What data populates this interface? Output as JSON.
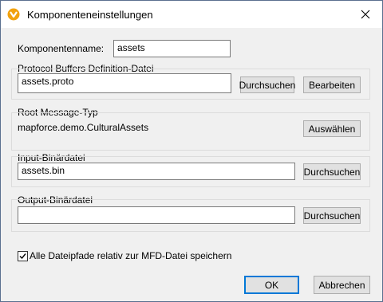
{
  "window": {
    "title": "Komponenteneinstellungen",
    "app_icon": "mapforce-icon",
    "close_icon": "close-icon"
  },
  "component_name": {
    "label": "Komponentenname:",
    "value": "assets"
  },
  "proto_file": {
    "group_label": "Protocol Buffers Definition-Datei",
    "value": "assets.proto",
    "browse_label": "Durchsuchen",
    "edit_label": "Bearbeiten"
  },
  "root_message": {
    "group_label": "Root Message-Typ",
    "value": "mapforce.demo.CulturalAssets",
    "select_label": "Auswählen"
  },
  "input_file": {
    "group_label": "Input-Binärdatei",
    "value": "assets.bin",
    "browse_label": "Durchsuchen"
  },
  "output_file": {
    "group_label": "Output-Binärdatei",
    "value": "",
    "browse_label": "Durchsuchen"
  },
  "relative_paths": {
    "label": "Alle Dateipfade relativ zur MFD-Datei speichern",
    "checked": true
  },
  "footer": {
    "ok_label": "OK",
    "cancel_label": "Abbrechen"
  },
  "colors": {
    "accent": "#0078d7",
    "icon_orange": "#f2a20d"
  }
}
